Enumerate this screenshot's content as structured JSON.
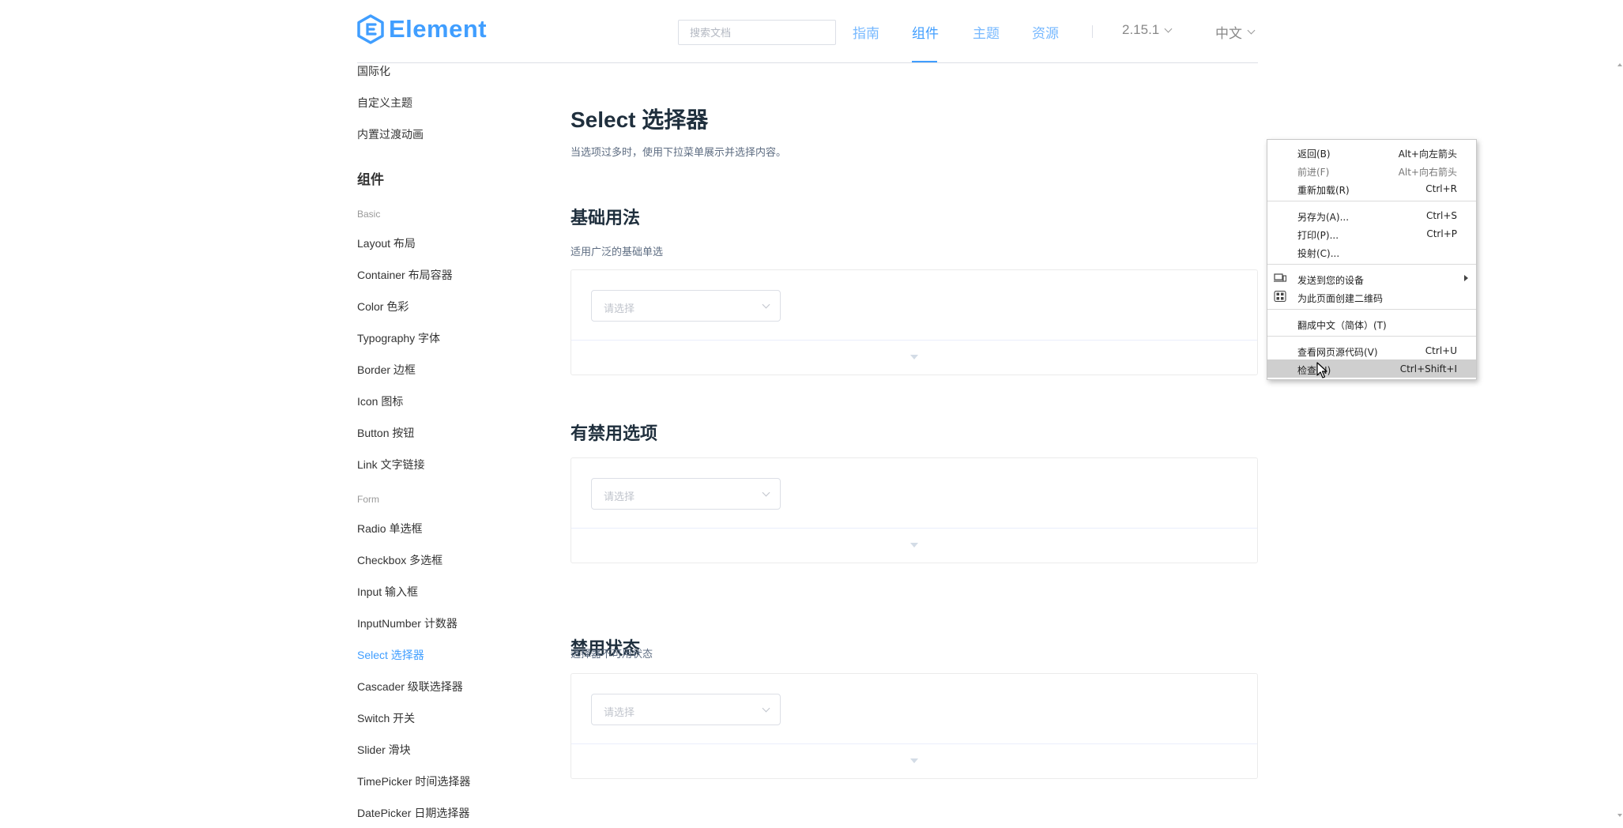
{
  "header": {
    "logo_text": "Element",
    "search_placeholder": "搜索文档",
    "nav": [
      "指南",
      "组件",
      "主题",
      "资源"
    ],
    "version": "2.15.1",
    "language": "中文"
  },
  "sidebar": {
    "top_links": [
      "国际化",
      "自定义主题",
      "内置过渡动画"
    ],
    "group": "组件",
    "basic_label": "Basic",
    "basic_items": [
      "Layout 布局",
      "Container 布局容器",
      "Color 色彩",
      "Typography 字体",
      "Border 边框",
      "Icon 图标",
      "Button 按钮",
      "Link 文字链接"
    ],
    "form_label": "Form",
    "form_items": [
      "Radio 单选框",
      "Checkbox 多选框",
      "Input 输入框",
      "InputNumber 计数器",
      "Select 选择器",
      "Cascader 级联选择器",
      "Switch 开关",
      "Slider 滑块",
      "TimePicker 时间选择器",
      "DatePicker 日期选择器"
    ]
  },
  "main": {
    "title": "Select 选择器",
    "description": "当选项过多时，使用下拉菜单展示并选择内容。",
    "select_placeholder": "请选择",
    "sections": [
      {
        "title": "基础用法",
        "desc": "适用广泛的基础单选"
      },
      {
        "title": "有禁用选项",
        "desc": ""
      },
      {
        "title": "禁用状态",
        "desc": "选择器不可用状态"
      }
    ]
  },
  "context_menu": {
    "items": [
      {
        "label": "返回(B)",
        "shortcut": "Alt+向左箭头"
      },
      {
        "label": "前进(F)",
        "shortcut": "Alt+向右箭头"
      },
      {
        "label": "重新加载(R)",
        "shortcut": "Ctrl+R"
      },
      {
        "label": "另存为(A)...",
        "shortcut": "Ctrl+S"
      },
      {
        "label": "打印(P)...",
        "shortcut": "Ctrl+P"
      },
      {
        "label": "投射(C)...",
        "shortcut": ""
      },
      {
        "label": "发送到您的设备",
        "shortcut": ""
      },
      {
        "label": "为此页面创建二维码",
        "shortcut": ""
      },
      {
        "label": "翻成中文（简体）(T)",
        "shortcut": ""
      },
      {
        "label": "查看网页源代码(V)",
        "shortcut": "Ctrl+U"
      },
      {
        "label": "检查(N)",
        "shortcut": "Ctrl+Shift+I"
      }
    ]
  },
  "colors": {
    "accent": "#409eff",
    "text": "#1f2f3d",
    "muted": "#5e6d82"
  }
}
